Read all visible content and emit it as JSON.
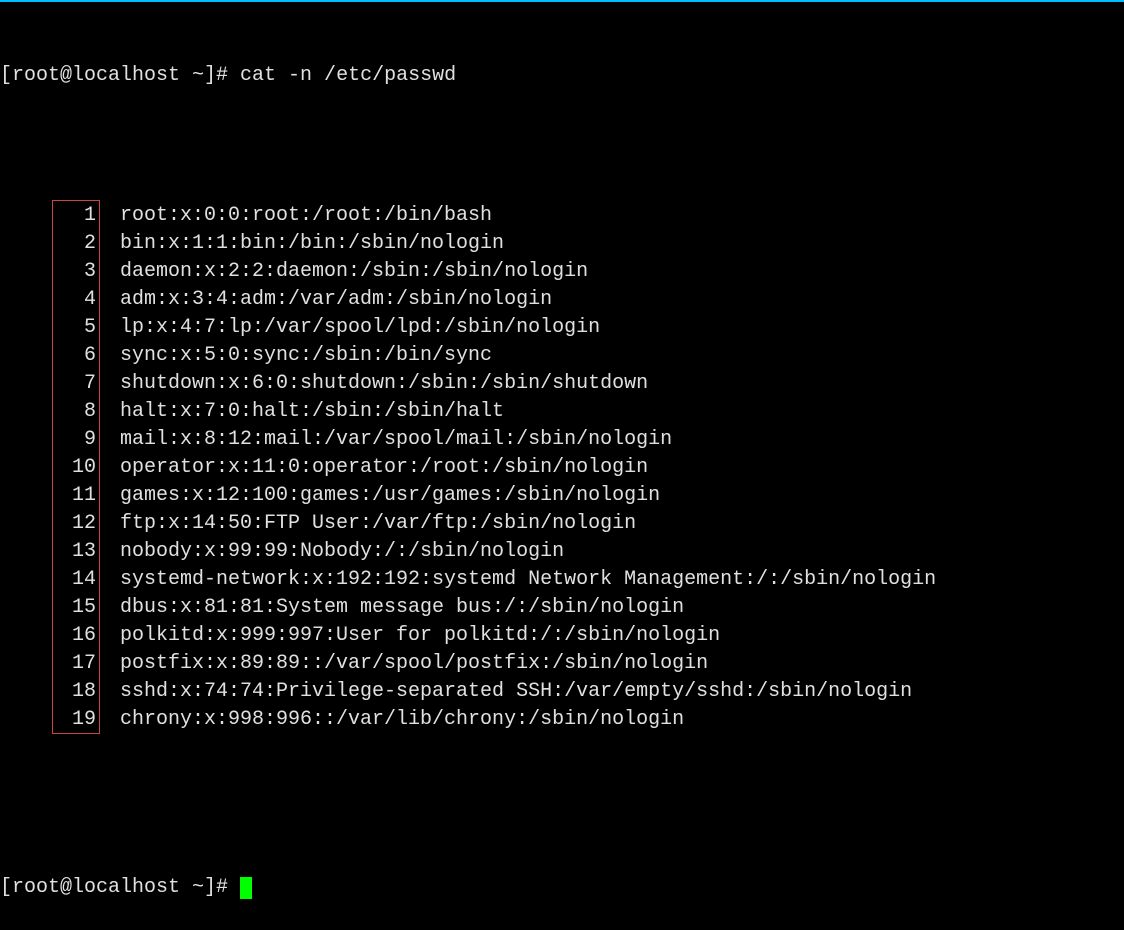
{
  "prompt1": {
    "prefix": "[root@localhost ~]# ",
    "command": "cat -n /etc/passwd"
  },
  "lines": [
    {
      "n": "1",
      "text": "root:x:0:0:root:/root:/bin/bash"
    },
    {
      "n": "2",
      "text": "bin:x:1:1:bin:/bin:/sbin/nologin"
    },
    {
      "n": "3",
      "text": "daemon:x:2:2:daemon:/sbin:/sbin/nologin"
    },
    {
      "n": "4",
      "text": "adm:x:3:4:adm:/var/adm:/sbin/nologin"
    },
    {
      "n": "5",
      "text": "lp:x:4:7:lp:/var/spool/lpd:/sbin/nologin"
    },
    {
      "n": "6",
      "text": "sync:x:5:0:sync:/sbin:/bin/sync"
    },
    {
      "n": "7",
      "text": "shutdown:x:6:0:shutdown:/sbin:/sbin/shutdown"
    },
    {
      "n": "8",
      "text": "halt:x:7:0:halt:/sbin:/sbin/halt"
    },
    {
      "n": "9",
      "text": "mail:x:8:12:mail:/var/spool/mail:/sbin/nologin"
    },
    {
      "n": "10",
      "text": "operator:x:11:0:operator:/root:/sbin/nologin"
    },
    {
      "n": "11",
      "text": "games:x:12:100:games:/usr/games:/sbin/nologin"
    },
    {
      "n": "12",
      "text": "ftp:x:14:50:FTP User:/var/ftp:/sbin/nologin"
    },
    {
      "n": "13",
      "text": "nobody:x:99:99:Nobody:/:/sbin/nologin"
    },
    {
      "n": "14",
      "text": "systemd-network:x:192:192:systemd Network Management:/:/sbin/nologin"
    },
    {
      "n": "15",
      "text": "dbus:x:81:81:System message bus:/:/sbin/nologin"
    },
    {
      "n": "16",
      "text": "polkitd:x:999:997:User for polkitd:/:/sbin/nologin"
    },
    {
      "n": "17",
      "text": "postfix:x:89:89::/var/spool/postfix:/sbin/nologin"
    },
    {
      "n": "18",
      "text": "sshd:x:74:74:Privilege-separated SSH:/var/empty/sshd:/sbin/nologin"
    },
    {
      "n": "19",
      "text": "chrony:x:998:996::/var/lib/chrony:/sbin/nologin"
    }
  ],
  "prompt2": {
    "prefix": "[root@localhost ~]# "
  }
}
